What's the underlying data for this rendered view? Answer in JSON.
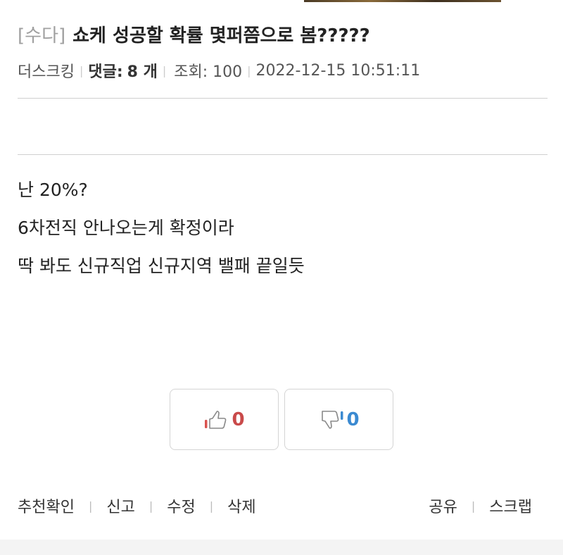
{
  "post": {
    "category": "[수다]",
    "title": "쇼케 성공할 확률 몇퍼쯤으로 봄?????",
    "author": "더스크킹",
    "comments_label": "댓글:",
    "comments_count": "8 개",
    "views": "조회: 100",
    "datetime": "2022-12-15 10:51:11",
    "body_lines": [
      "난 20%?",
      "6차전직 안나오는게 확정이라",
      "딱 봐도 신규직업 신규지역 밸패 끝일듯"
    ]
  },
  "votes": {
    "up_count": "0",
    "down_count": "0",
    "up_icon": "thumbs-up-icon",
    "down_icon": "thumbs-down-icon",
    "up_color": "#c94a4a",
    "down_color": "#3b8ad1"
  },
  "actions": {
    "left": [
      "추천확인",
      "신고",
      "수정",
      "삭제"
    ],
    "right": [
      "공유",
      "스크랩"
    ]
  }
}
